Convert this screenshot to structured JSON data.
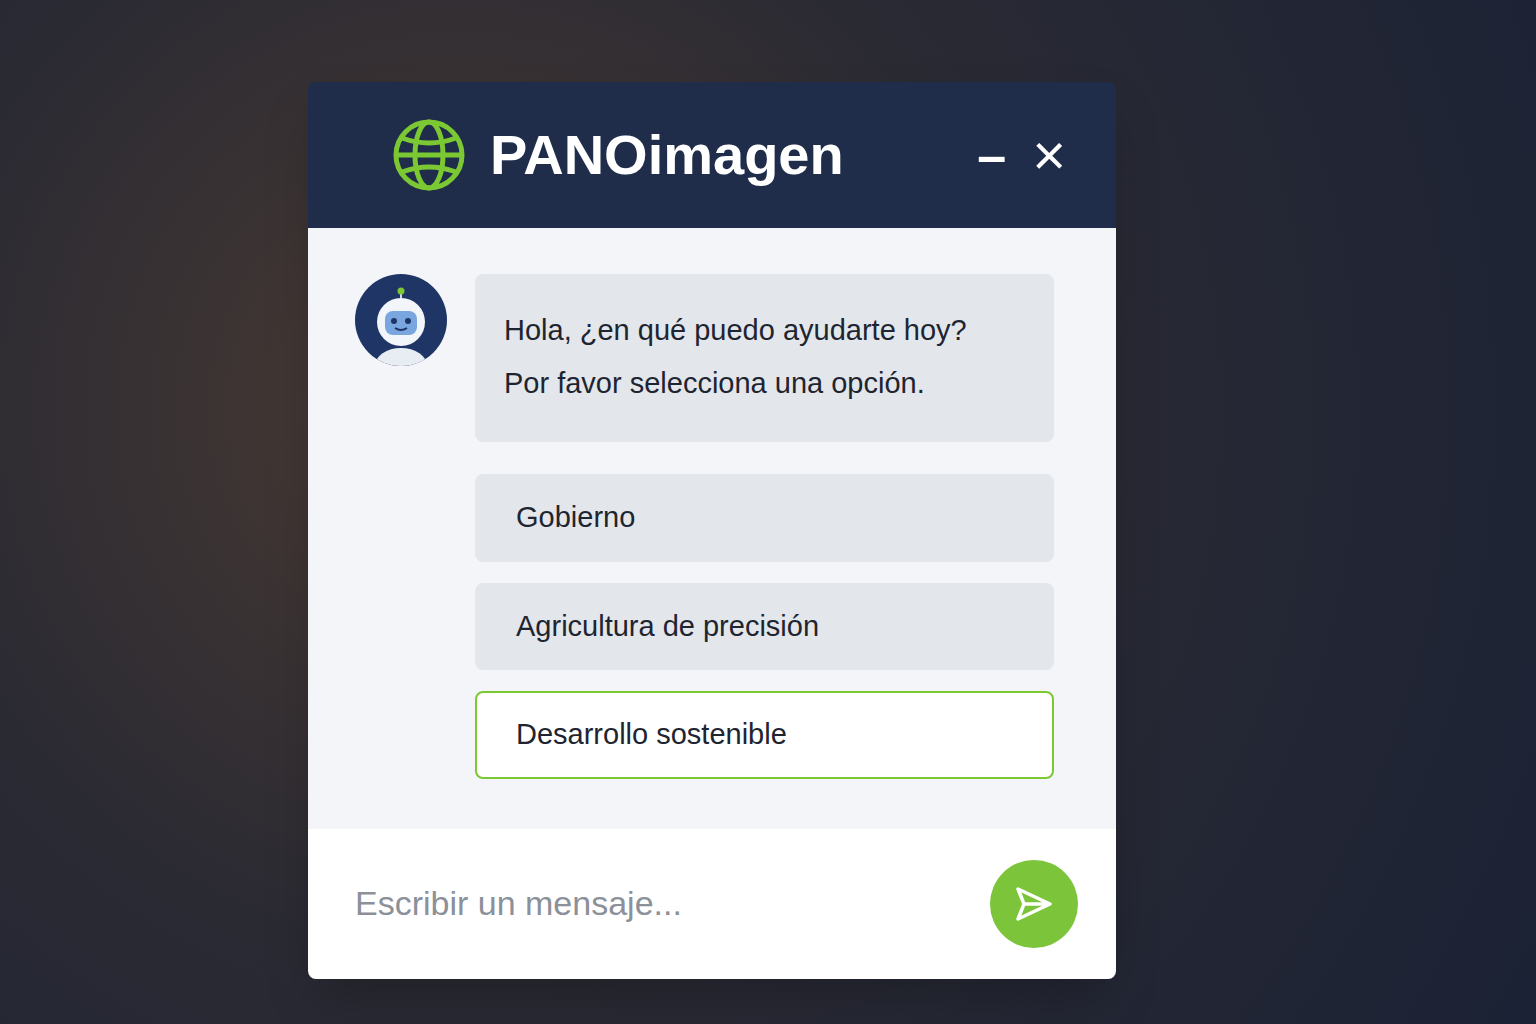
{
  "window": {
    "title": "PANOimagen",
    "minimize": "–",
    "close": "×"
  },
  "messages": [
    {
      "sender": "bot",
      "lines": [
        "Hola, ¿en qué puedo ayudarte hoy?",
        "Por favor selecciona una opción."
      ]
    }
  ],
  "options": [
    {
      "label": "Gobierno",
      "selected": false
    },
    {
      "label": "Agricultura de precisión",
      "selected": false
    },
    {
      "label": "Desarrollo sostenible",
      "selected": true
    }
  ],
  "input": {
    "placeholder": "Escribir un mensaje..."
  }
}
